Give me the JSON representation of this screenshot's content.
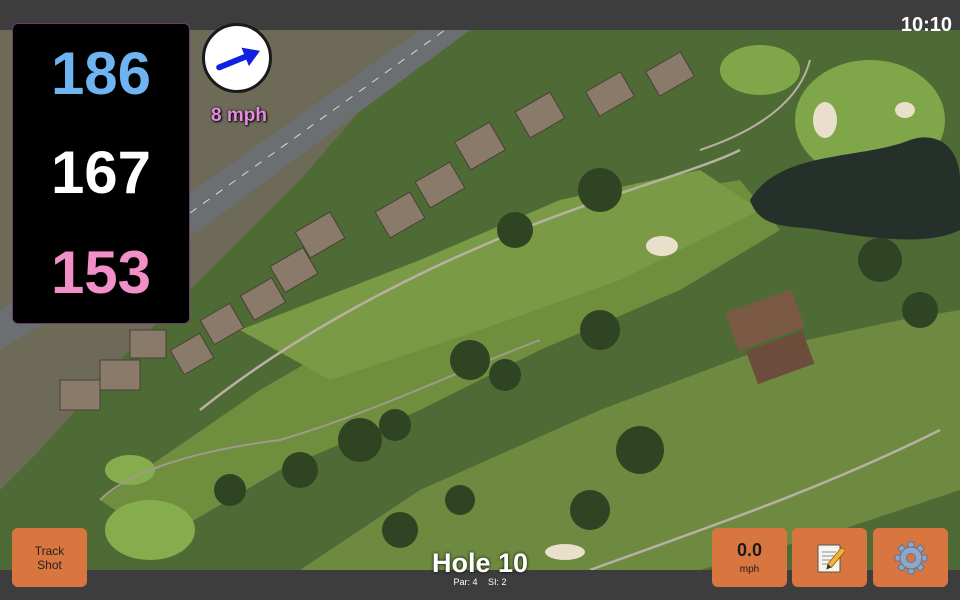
{
  "status": {
    "time": "10:10"
  },
  "distances": {
    "back": "186",
    "middle": "167",
    "front": "153"
  },
  "wind": {
    "speed": "8 mph",
    "direction_icon": "wind-arrow-icon"
  },
  "buttons": {
    "track_shot_line1": "Track",
    "track_shot_line2": "Shot",
    "speed_value": "0.0",
    "speed_unit": "mph",
    "notes_icon": "notepad-icon",
    "settings_icon": "gear-icon"
  },
  "hole": {
    "title": "Hole 10",
    "par": "Par: 4",
    "si": "SI: 2"
  },
  "colors": {
    "back_distance": "#6eb4f0",
    "middle_distance": "#ffffff",
    "front_distance": "#f28ec8",
    "wind_speed": "#e58ae0",
    "button": "#d9763f"
  }
}
